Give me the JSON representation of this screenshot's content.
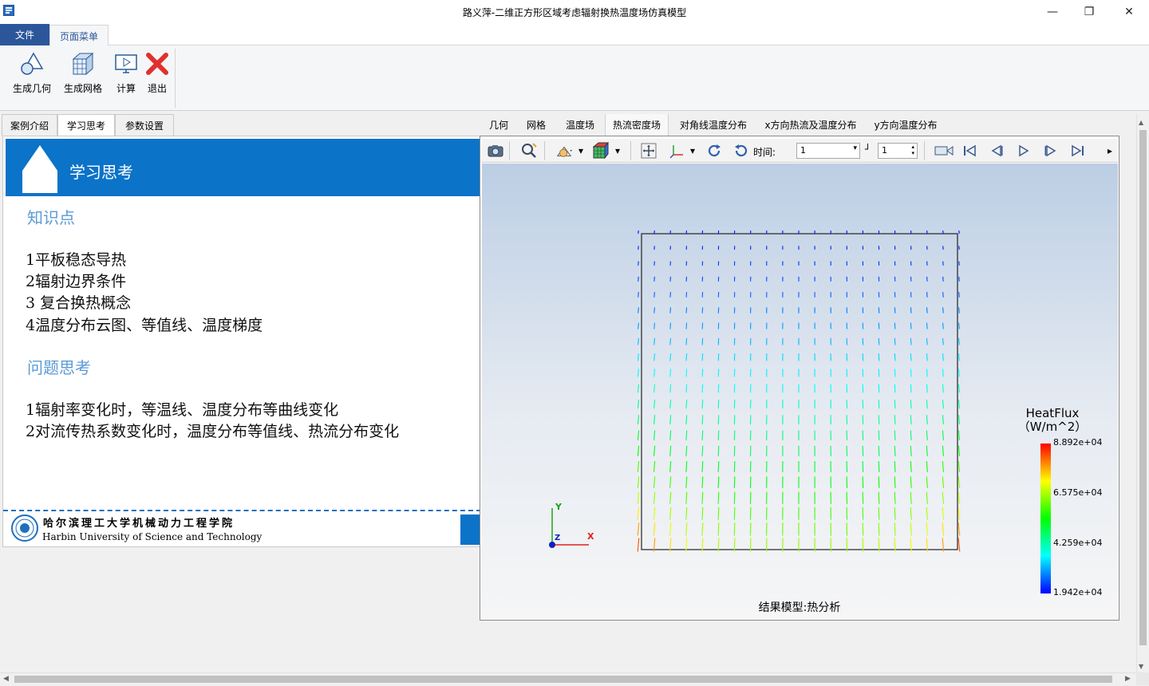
{
  "window": {
    "title": "路义萍-二维正方形区域考虑辐射换热温度场仿真模型",
    "minimize": "—",
    "maximize": "❐",
    "close": "✕"
  },
  "menu": {
    "file": "文件",
    "page_menu": "页面菜单"
  },
  "ribbon": {
    "gen_geometry": "生成几何",
    "gen_mesh": "生成网格",
    "compute": "计算",
    "exit": "退出"
  },
  "left_tabs": [
    "案例介绍",
    "学习思考",
    "参数设置"
  ],
  "left_panel": {
    "banner_title": "学习思考",
    "knowledge_heading": "知识点",
    "knowledge_items": [
      "1平板稳态导热",
      "2辐射边界条件",
      "3 复合换热概念",
      "4温度分布云图、等值线、温度梯度"
    ],
    "question_heading": "问题思考",
    "question_items": [
      "1辐射率变化时，等温线、温度分布等曲线变化",
      "2对流传热系数变化时，温度分布等值线、热流分布变化"
    ],
    "university_cn": "哈尔滨理工大学机械动力工程学院",
    "university_en": "Harbin University of Science and Technology"
  },
  "right_tabs": [
    "几何",
    "网格",
    "温度场",
    "热流密度场",
    "对角线温度分布",
    "x方向热流及温度分布",
    "y方向温度分布"
  ],
  "active_right_tab": 3,
  "viewer_toolbar": {
    "time_label": "时间:",
    "time_value": "1",
    "step_value": "1"
  },
  "viewport": {
    "result_label": "结果模型:热分析",
    "axes": {
      "x": "X",
      "y": "Y",
      "z": "Z"
    },
    "legend": {
      "title": "HeatFlux",
      "unit": "（W/m^2）",
      "max": "8.892e+04",
      "v2": "6.575e+04",
      "v3": "4.259e+04",
      "min": "1.942e+04"
    }
  },
  "colors": {
    "accent": "#2b579a",
    "banner": "#0b73c8",
    "heading": "#5b9bd5"
  }
}
